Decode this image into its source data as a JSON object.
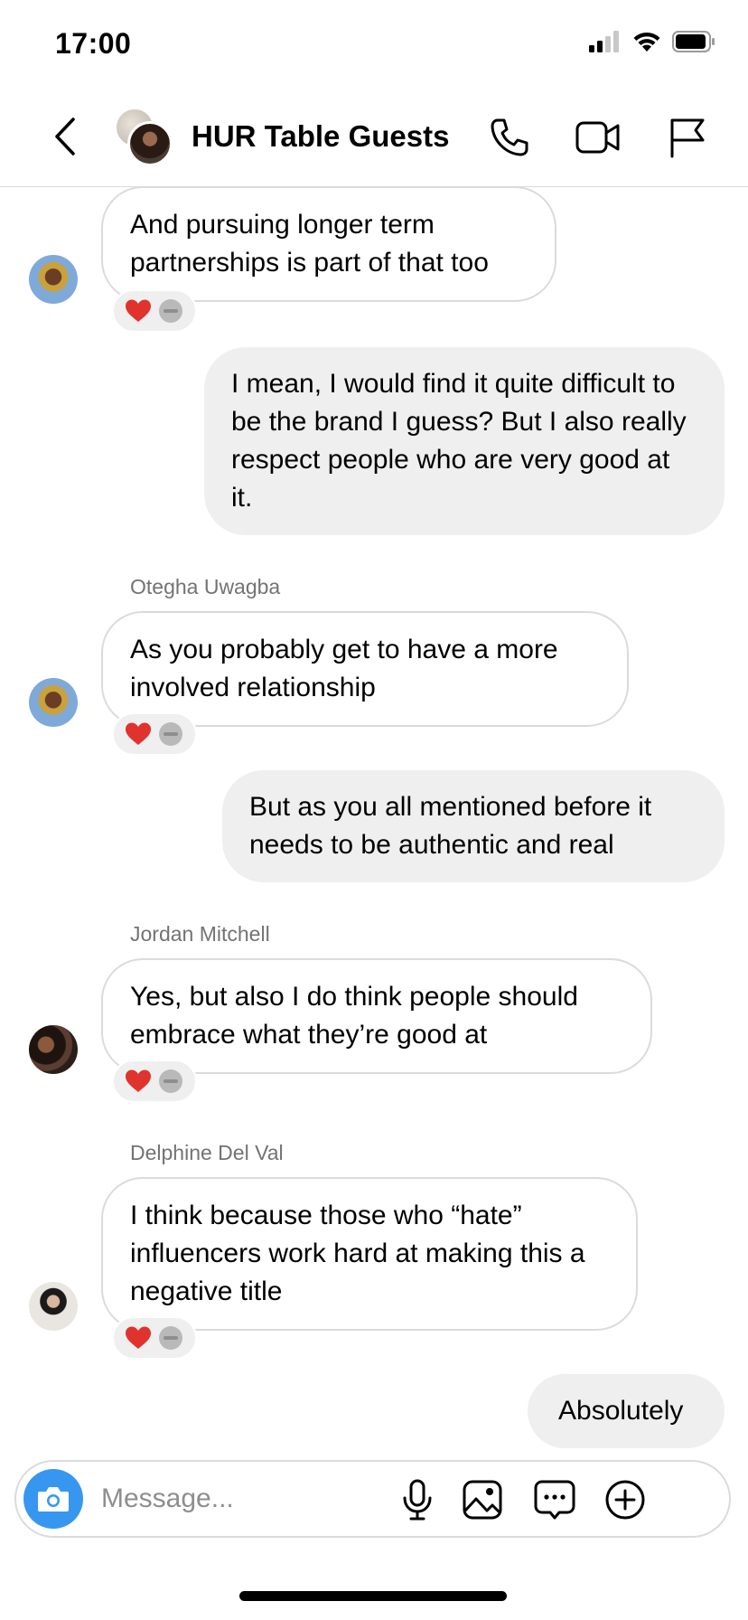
{
  "status_bar": {
    "time": "17:00"
  },
  "header": {
    "title": "HUR Table Guests"
  },
  "messages": [
    {
      "text": "And pursuing longer term partnerships is part of that too"
    },
    {
      "text": "I mean, I would find it quite difficult to be the brand I guess? But I also really respect people who are very good at it."
    },
    {
      "sender": "Otegha Uwagba",
      "text": "As you probably get to have a more involved relationship"
    },
    {
      "text": "But as you all mentioned before it needs to be authentic and real"
    },
    {
      "sender": "Jordan Mitchell",
      "text": "Yes, but also I do think people should embrace what they’re good at"
    },
    {
      "sender": "Delphine Del Val",
      "text": "I think because those who “hate” influencers work hard at making this a negative title"
    },
    {
      "text": "Absolutely"
    }
  ],
  "composer": {
    "placeholder": "Message..."
  },
  "colors": {
    "accent": "#3797f0",
    "bubble_out": "#efefef",
    "bubble_border": "#dbdbdb",
    "heart": "#e0332e"
  },
  "icons": [
    "back-icon",
    "phone-icon",
    "video-icon",
    "flag-icon",
    "heart-icon",
    "camera-icon",
    "microphone-icon",
    "image-icon",
    "sticker-icon",
    "plus-icon"
  ]
}
